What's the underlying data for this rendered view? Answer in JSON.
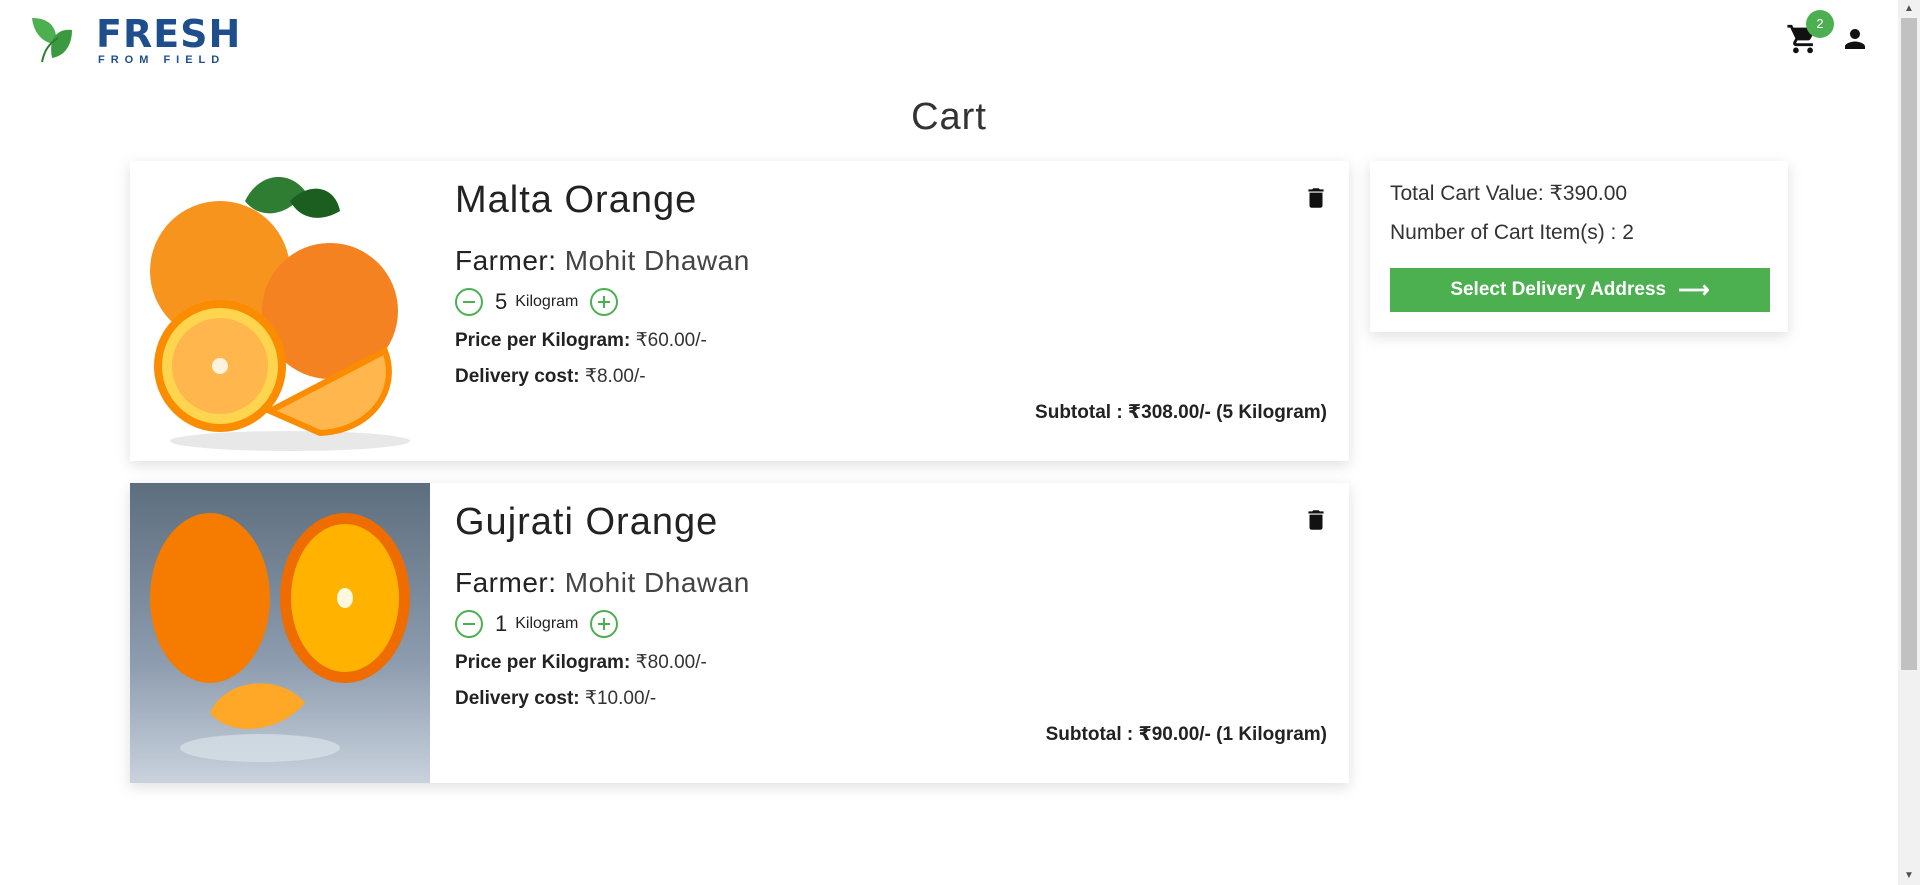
{
  "header": {
    "logo_text": "FRESH",
    "logo_sub": "FROM FIELD",
    "cart_count": "2",
    "cart_icon": "shopping-cart-icon",
    "user_icon": "person-icon"
  },
  "page_title": "Cart",
  "items": [
    {
      "name": "Malta Orange",
      "farmer_label": "Farmer:",
      "farmer_name": "Mohit Dhawan",
      "quantity": "5",
      "unit": "Kilogram",
      "price_label": "Price per Kilogram:",
      "price_value": "₹60.00/-",
      "delivery_label": "Delivery cost:",
      "delivery_value": "₹8.00/-",
      "subtotal": "Subtotal : ₹308.00/- (5 Kilogram)"
    },
    {
      "name": "Gujrati Orange",
      "farmer_label": "Farmer:",
      "farmer_name": "Mohit Dhawan",
      "quantity": "1",
      "unit": "Kilogram",
      "price_label": "Price per Kilogram:",
      "price_value": "₹80.00/-",
      "delivery_label": "Delivery cost:",
      "delivery_value": "₹10.00/-",
      "subtotal": "Subtotal : ₹90.00/- (1 Kilogram)"
    }
  ],
  "summary": {
    "total_label": "Total Cart Value: ₹390.00",
    "count_label": "Number of Cart Item(s) : 2",
    "button_label": "Select Delivery Address",
    "button_arrow": "⟶"
  },
  "colors": {
    "accent": "#4caf50",
    "brand": "#1f4e8c"
  }
}
